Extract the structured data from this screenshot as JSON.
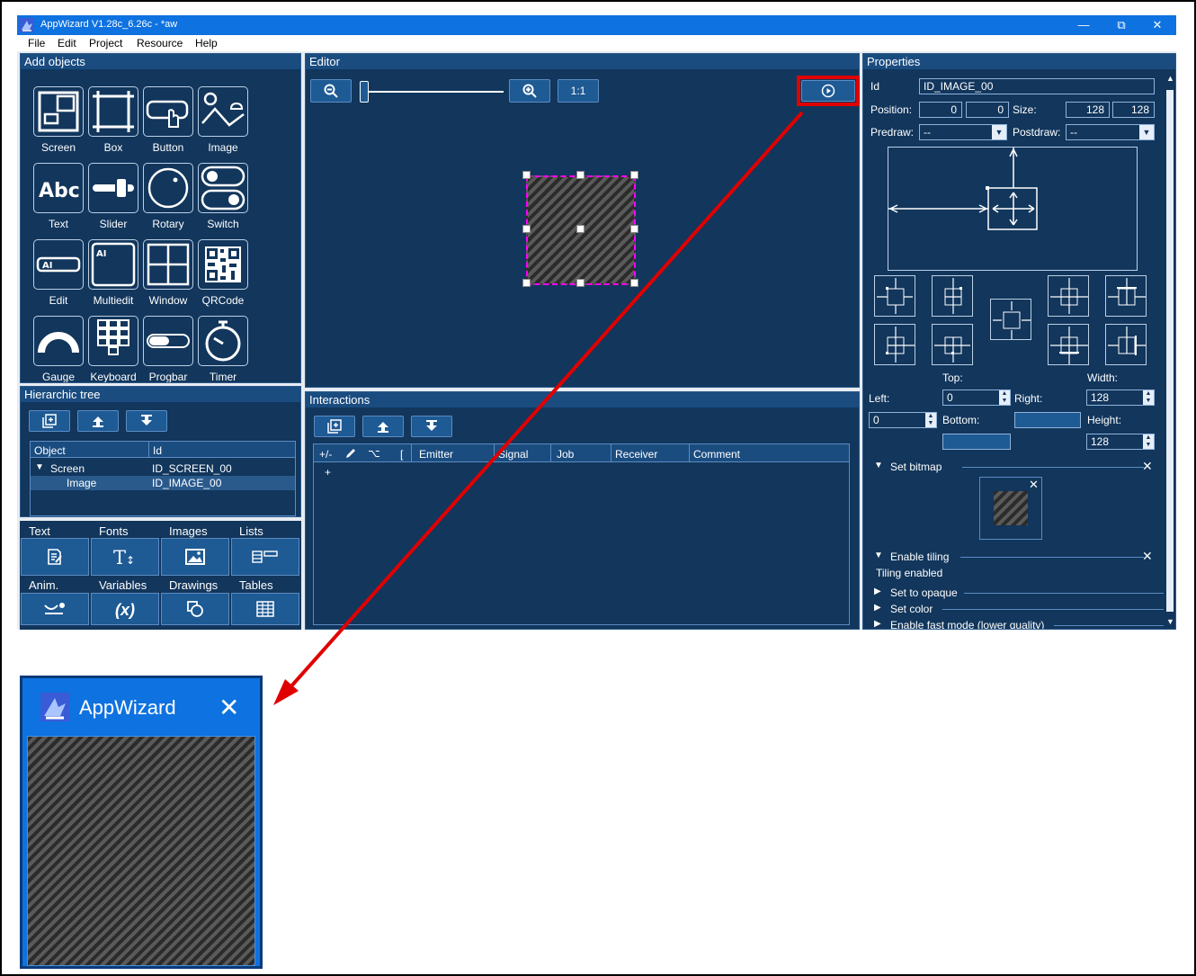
{
  "window": {
    "title": "AppWizard V1.28c_6.26c - *aw",
    "minimize": "—",
    "restore": "⧉",
    "close": "✕"
  },
  "menu": [
    "File",
    "Edit",
    "Project",
    "Resource",
    "Help"
  ],
  "add_objects": {
    "title": "Add objects",
    "items": [
      "Screen",
      "Box",
      "Button",
      "Image",
      "Text",
      "Slider",
      "Rotary",
      "Switch",
      "Edit",
      "Multiedit",
      "Window",
      "QRCode",
      "Gauge",
      "Keyboard",
      "Progbar",
      "Timer"
    ]
  },
  "editor": {
    "title": "Editor",
    "zoom_reset": "1:1",
    "zoom_level": 0.0
  },
  "hierarchic_tree": {
    "title": "Hierarchic tree",
    "columns": [
      "Object",
      "Id"
    ],
    "rows": [
      {
        "object": "Screen",
        "id": "ID_SCREEN_00",
        "expander": "▼"
      },
      {
        "object": "Image",
        "id": "ID_IMAGE_00"
      }
    ]
  },
  "resources": {
    "tabs_row1": [
      "Text",
      "Fonts",
      "Images",
      "Lists"
    ],
    "tabs_row2": [
      "Anim.",
      "Variables",
      "Drawings",
      "Tables"
    ],
    "variables_glyph": "(x)"
  },
  "interactions": {
    "title": "Interactions",
    "columns": [
      "+/-",
      "",
      "",
      "[",
      "Emitter",
      "Signal",
      "Job",
      "Receiver",
      "Comment"
    ],
    "add_row": "+"
  },
  "properties": {
    "title": "Properties",
    "id_label": "Id",
    "id_value": "ID_IMAGE_00",
    "position_label": "Position:",
    "pos_x": "0",
    "pos_y": "0",
    "size_label": "Size:",
    "size_w": "128",
    "size_h": "128",
    "predraw_label": "Predraw:",
    "predraw_value": "--",
    "postdraw_label": "Postdraw:",
    "postdraw_value": "--",
    "top_label": "Top:",
    "width_label": "Width:",
    "left_label": "Left:",
    "left_value": "0",
    "right_label": "Right:",
    "right_value": "128",
    "left2_value": "0",
    "bottom_label": "Bottom:",
    "height_label": "Height:",
    "height_value": "128",
    "set_bitmap": "Set bitmap",
    "enable_tiling": "Enable tiling",
    "tiling_enabled": "Tiling enabled",
    "set_opaque": "Set to opaque",
    "set_color": "Set color",
    "fast_mode": "Enable fast mode (lower quality)",
    "expanded_glyph": "▼",
    "collapsed_glyph": "▶",
    "close_glyph": "✕"
  },
  "preview": {
    "title": "AppWizard",
    "close": "✕"
  },
  "colors": {
    "panel": "#12365c",
    "header": "#1a4c80",
    "titlebar": "#0e72e0",
    "highlight": "#e00000",
    "selection": "#ff00ff"
  }
}
